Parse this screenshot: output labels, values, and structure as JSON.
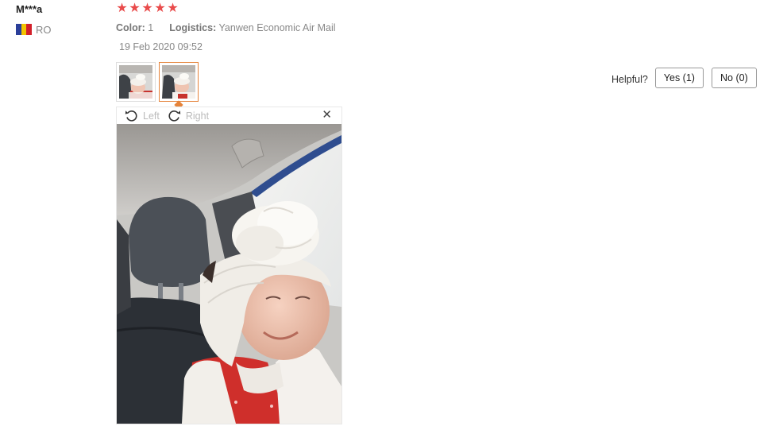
{
  "reviewer": {
    "name": "M***a",
    "country_code": "RO",
    "flag_colors": [
      "#2b3f9a",
      "#f2c400",
      "#d3202b"
    ]
  },
  "review": {
    "rating": 5,
    "stars": [
      "★",
      "★",
      "★",
      "★",
      "★"
    ],
    "star_color": "#e94b4b",
    "color_label": "Color:",
    "color_value": "1",
    "logistics_label": "Logistics:",
    "logistics_value": "Yanwen Economic Air Mail",
    "date": "19 Feb 2020 09:52"
  },
  "photos": {
    "thumbnails": [
      "photo-1",
      "photo-2"
    ],
    "active_index": 1,
    "accent_color": "#e5833a"
  },
  "viewer": {
    "rotate_left_label": "Left",
    "rotate_right_label": "Right",
    "close_glyph": "✕"
  },
  "helpful": {
    "label": "Helpful?",
    "yes_label": "Yes (1)",
    "no_label": "No (0)"
  }
}
